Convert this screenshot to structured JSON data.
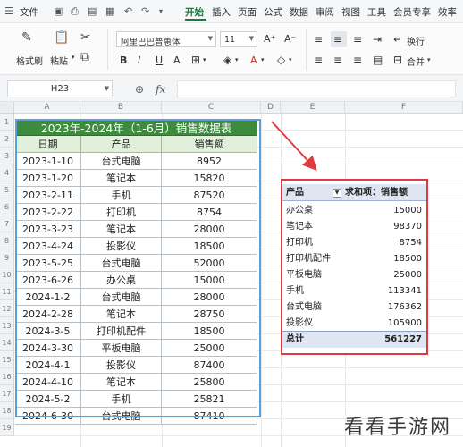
{
  "menubar": {
    "file": "文件",
    "tabs": [
      "开始",
      "插入",
      "页面",
      "公式",
      "数据",
      "审阅",
      "视图",
      "工具",
      "会员专享",
      "效率"
    ],
    "active_tab": "开始"
  },
  "toolbar": {
    "format_painter": "格式刷",
    "paste": "粘贴",
    "font_name": "阿里巴巴普惠体",
    "font_size": "11",
    "wrap": "换行",
    "merge": "合并"
  },
  "formula_bar": {
    "cell_ref": "H23",
    "fx": "fx"
  },
  "columns": [
    "A",
    "B",
    "C",
    "D",
    "E",
    "F"
  ],
  "rows": [
    "1",
    "2",
    "3",
    "4",
    "5",
    "6",
    "7",
    "8",
    "9",
    "10",
    "11",
    "12",
    "13",
    "14",
    "15",
    "16",
    "17",
    "18",
    "19"
  ],
  "source_table": {
    "title": "2023年-2024年（1-6月）销售数据表",
    "headers": [
      "日期",
      "产品",
      "销售额"
    ],
    "rows": [
      [
        "2023-1-10",
        "台式电脑",
        "8952"
      ],
      [
        "2023-1-20",
        "笔记本",
        "15820"
      ],
      [
        "2023-2-11",
        "手机",
        "87520"
      ],
      [
        "2023-2-22",
        "打印机",
        "8754"
      ],
      [
        "2023-3-23",
        "笔记本",
        "28000"
      ],
      [
        "2023-4-24",
        "投影仪",
        "18500"
      ],
      [
        "2023-5-25",
        "台式电脑",
        "52000"
      ],
      [
        "2023-6-26",
        "办公桌",
        "15000"
      ],
      [
        "2024-1-2",
        "台式电脑",
        "28000"
      ],
      [
        "2024-2-28",
        "笔记本",
        "28750"
      ],
      [
        "2024-3-5",
        "打印机配件",
        "18500"
      ],
      [
        "2024-3-30",
        "平板电脑",
        "25000"
      ],
      [
        "2024-4-1",
        "投影仪",
        "87400"
      ],
      [
        "2024-4-10",
        "笔记本",
        "25800"
      ],
      [
        "2024-5-2",
        "手机",
        "25821"
      ],
      [
        "2024-6-30",
        "台式电脑",
        "87410"
      ]
    ]
  },
  "pivot_table": {
    "header_label": "产品",
    "header_value": "求和项：销售额",
    "rows": [
      [
        "办公桌",
        "15000"
      ],
      [
        "笔记本",
        "98370"
      ],
      [
        "打印机",
        "8754"
      ],
      [
        "打印机配件",
        "18500"
      ],
      [
        "平板电脑",
        "25000"
      ],
      [
        "手机",
        "113341"
      ],
      [
        "台式电脑",
        "176362"
      ],
      [
        "投影仪",
        "105900"
      ]
    ],
    "total_label": "总计",
    "total_value": "561227"
  },
  "watermark": "看看手游网",
  "colors": {
    "accent": "#1b7a3e",
    "title_fill": "#3d8b3d",
    "header_fill": "#e2efda",
    "selection_border": "#5aa0d6",
    "pivot_border": "#e0393e",
    "pivot_header_fill": "#dfe6f2"
  }
}
